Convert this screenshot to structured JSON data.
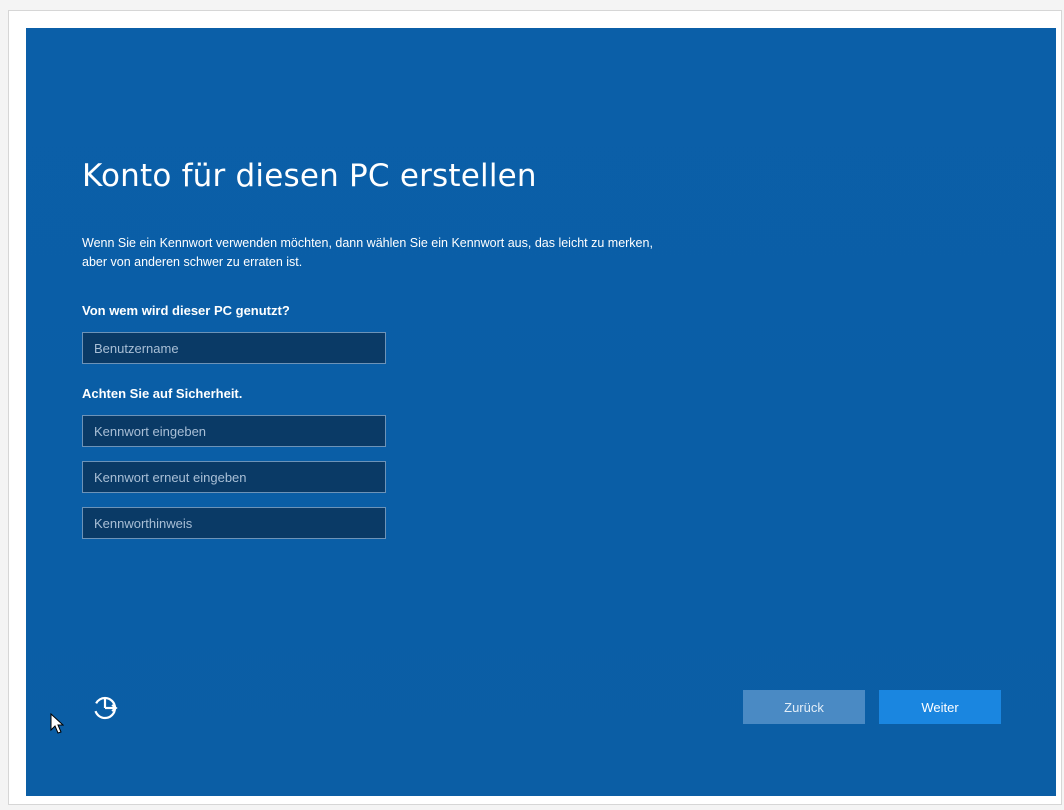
{
  "setup": {
    "title": "Konto für diesen PC erstellen",
    "description_line1": "Wenn Sie ein Kennwort verwenden möchten, dann wählen Sie ein Kennwort aus, das leicht zu merken,",
    "description_line2": "aber von anderen schwer zu erraten ist.",
    "user_section_label": "Von wem wird dieser PC genutzt?",
    "username_placeholder": "Benutzername",
    "username_value": "",
    "security_section_label": "Achten Sie auf Sicherheit.",
    "password_placeholder": "Kennwort eingeben",
    "password_value": "",
    "password_repeat_placeholder": "Kennwort erneut eingeben",
    "password_repeat_value": "",
    "hint_placeholder": "Kennworthinweis",
    "hint_value": ""
  },
  "footer": {
    "back_label": "Zurück",
    "next_label": "Weiter",
    "accessibility_icon": "ease-of-access-icon"
  },
  "colors": {
    "background": "#0a5ea6",
    "field_background": "#0a3a66",
    "back_button": "#4a8ac4",
    "next_button": "#1a86e0"
  }
}
